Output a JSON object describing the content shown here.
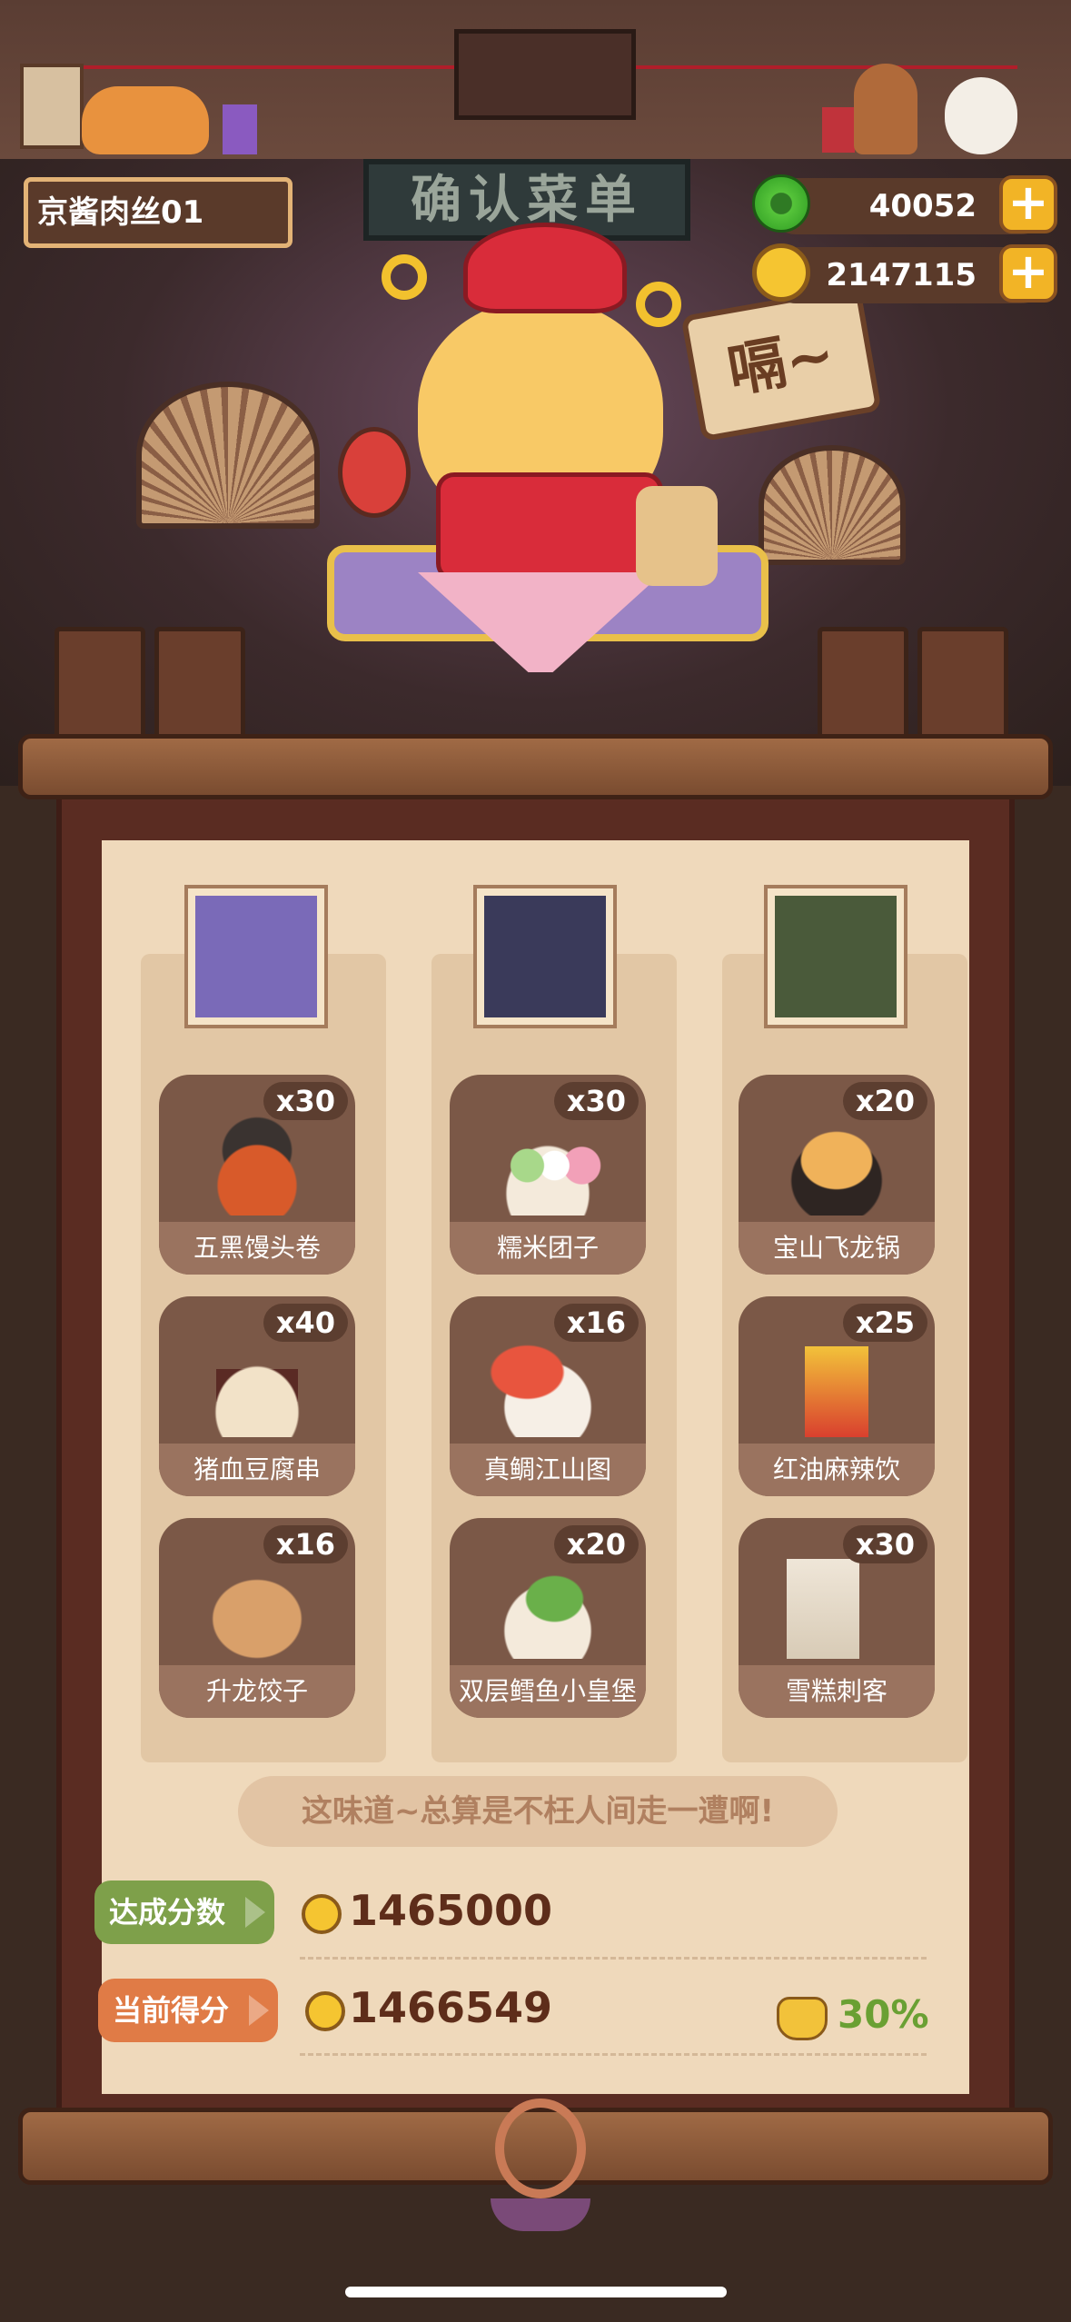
{
  "header": {
    "name_label": "京酱肉丝01",
    "title_sign": "确认菜单",
    "jade_currency": "40052",
    "coin_currency": "2147115",
    "speech_sign": "嗝~"
  },
  "columns": [
    {
      "portrait": "character-portrait-purple-hair",
      "dishes": [
        {
          "name": "五黑馒头卷",
          "qty": "x30"
        },
        {
          "name": "猪血豆腐串",
          "qty": "x40"
        },
        {
          "name": "升龙饺子",
          "qty": "x16"
        }
      ]
    },
    {
      "portrait": "character-portrait-black-hair-crown",
      "dishes": [
        {
          "name": "糯米团子",
          "qty": "x30"
        },
        {
          "name": "真鲷江山图",
          "qty": "x16"
        },
        {
          "name": "双层鳕鱼小皇堡",
          "qty": "x20"
        }
      ]
    },
    {
      "portrait": "character-portrait-fox-mask",
      "dishes": [
        {
          "name": "宝山飞龙锅",
          "qty": "x20"
        },
        {
          "name": "红油麻辣饮",
          "qty": "x25"
        },
        {
          "name": "雪糕刺客",
          "qty": "x30"
        }
      ]
    }
  ],
  "quote": "这味道~总算是不枉人间走一遭啊!",
  "score": {
    "target_label": "达成分数",
    "target_value": "1465000",
    "current_label": "当前得分",
    "current_value": "1466549",
    "bonus_percent": "30%"
  },
  "colors": {
    "target_tag": "#7ea04a",
    "current_tag": "#e07b46",
    "bonus_text": "#6aa033"
  }
}
